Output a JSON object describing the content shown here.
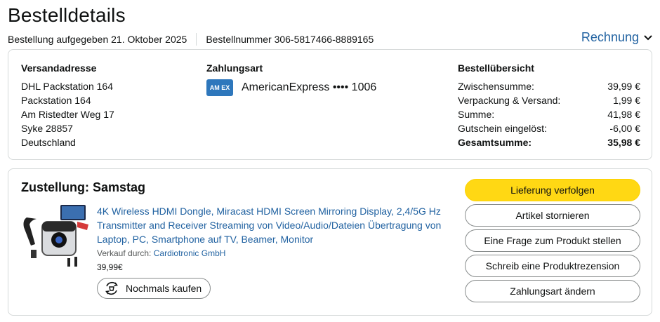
{
  "header": {
    "title": "Bestelldetails",
    "order_date": "Bestellung aufgegeben 21. Oktober 2025",
    "order_number": "Bestellnummer 306-5817466-8889165",
    "invoice_label": "Rechnung"
  },
  "shipping": {
    "heading": "Versandadresse",
    "lines": [
      "DHL Packstation 164",
      "Packstation 164",
      "Am Ristedter Weg 17",
      "Syke 28857",
      "Deutschland"
    ]
  },
  "payment": {
    "heading": "Zahlungsart",
    "card_logo_text": "AM EX",
    "card_text": "AmericanExpress •••• 1006"
  },
  "summary": {
    "heading": "Bestellübersicht",
    "rows": [
      {
        "label": "Zwischensumme:",
        "value": "39,99 €"
      },
      {
        "label": "Verpackung & Versand:",
        "value": "1,99 €"
      },
      {
        "label": "Summe:",
        "value": "41,98 €"
      },
      {
        "label": "Gutschein eingelöst:",
        "value": "-6,00 €"
      },
      {
        "label": "Gesamtsumme:",
        "value": "35,98 €"
      }
    ]
  },
  "delivery": {
    "heading": "Zustellung: Samstag",
    "product_title": "4K Wireless HDMI Dongle, Miracast HDMI Screen Mirroring Display, 2,4/5G Hz Transmitter and Receiver Streaming von Video/Audio/Dateien Übertragung von Laptop, PC, Smartphone auf TV, Beamer, Monitor",
    "seller_prefix": "Verkauf durch:",
    "seller_name": "Cardiotronic GmbH",
    "price": "39,99€",
    "buy_again": "Nochmals kaufen"
  },
  "actions": {
    "track": "Lieferung verfolgen",
    "cancel": "Artikel stornieren",
    "question": "Eine Frage zum Produkt stellen",
    "review": "Schreib eine Produktrezension",
    "change_payment": "Zahlungsart ändern"
  },
  "colors": {
    "link": "#2162a1",
    "primary_button": "#ffd814",
    "amex": "#2e77bc"
  }
}
